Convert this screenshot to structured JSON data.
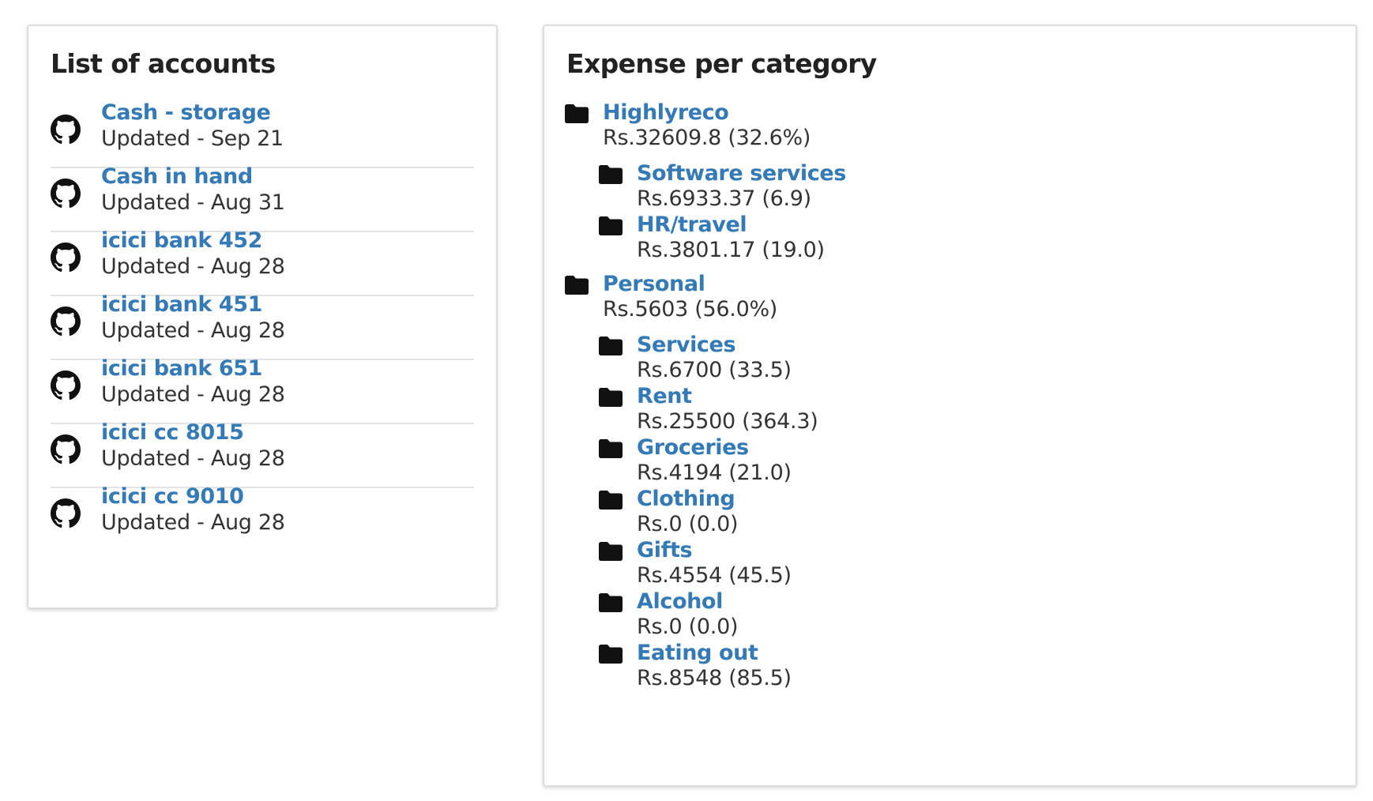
{
  "accounts_panel": {
    "title": "List of accounts",
    "accounts": [
      {
        "name": "Cash - storage",
        "updated": "Updated - Sep 21"
      },
      {
        "name": "Cash in hand",
        "updated": "Updated - Aug 31"
      },
      {
        "name": "icici bank 452",
        "updated": "Updated - Aug 28"
      },
      {
        "name": "icici bank 451",
        "updated": "Updated - Aug 28"
      },
      {
        "name": "icici bank 651",
        "updated": "Updated - Aug 28"
      },
      {
        "name": "icici cc 8015",
        "updated": "Updated - Aug 28"
      },
      {
        "name": "icici cc 9010",
        "updated": "Updated - Aug 28"
      }
    ],
    "account_icon": "github-icon"
  },
  "expense_panel": {
    "title": "Expense per category",
    "category_icon": "folder-icon",
    "groups": [
      {
        "name": "Highlyreco",
        "amount": "Rs.32609.8 (32.6%)",
        "children": [
          {
            "name": "Software services",
            "amount": "Rs.6933.37 (6.9)"
          },
          {
            "name": "HR/travel",
            "amount": "Rs.3801.17 (19.0)"
          }
        ]
      },
      {
        "name": "Personal",
        "amount": "Rs.5603 (56.0%)",
        "children": [
          {
            "name": "Services",
            "amount": "Rs.6700 (33.5)"
          },
          {
            "name": "Rent",
            "amount": "Rs.25500 (364.3)"
          },
          {
            "name": "Groceries",
            "amount": "Rs.4194 (21.0)"
          },
          {
            "name": "Clothing",
            "amount": "Rs.0 (0.0)"
          },
          {
            "name": "Gifts",
            "amount": "Rs.4554 (45.5)"
          },
          {
            "name": "Alcohol",
            "amount": "Rs.0 (0.0)"
          },
          {
            "name": "Eating out",
            "amount": "Rs.8548 (85.5)"
          }
        ]
      }
    ]
  },
  "colors": {
    "link": "#337ab7",
    "text": "#333333",
    "title": "#222222",
    "icon": "#111111",
    "border": "#dddddd"
  }
}
